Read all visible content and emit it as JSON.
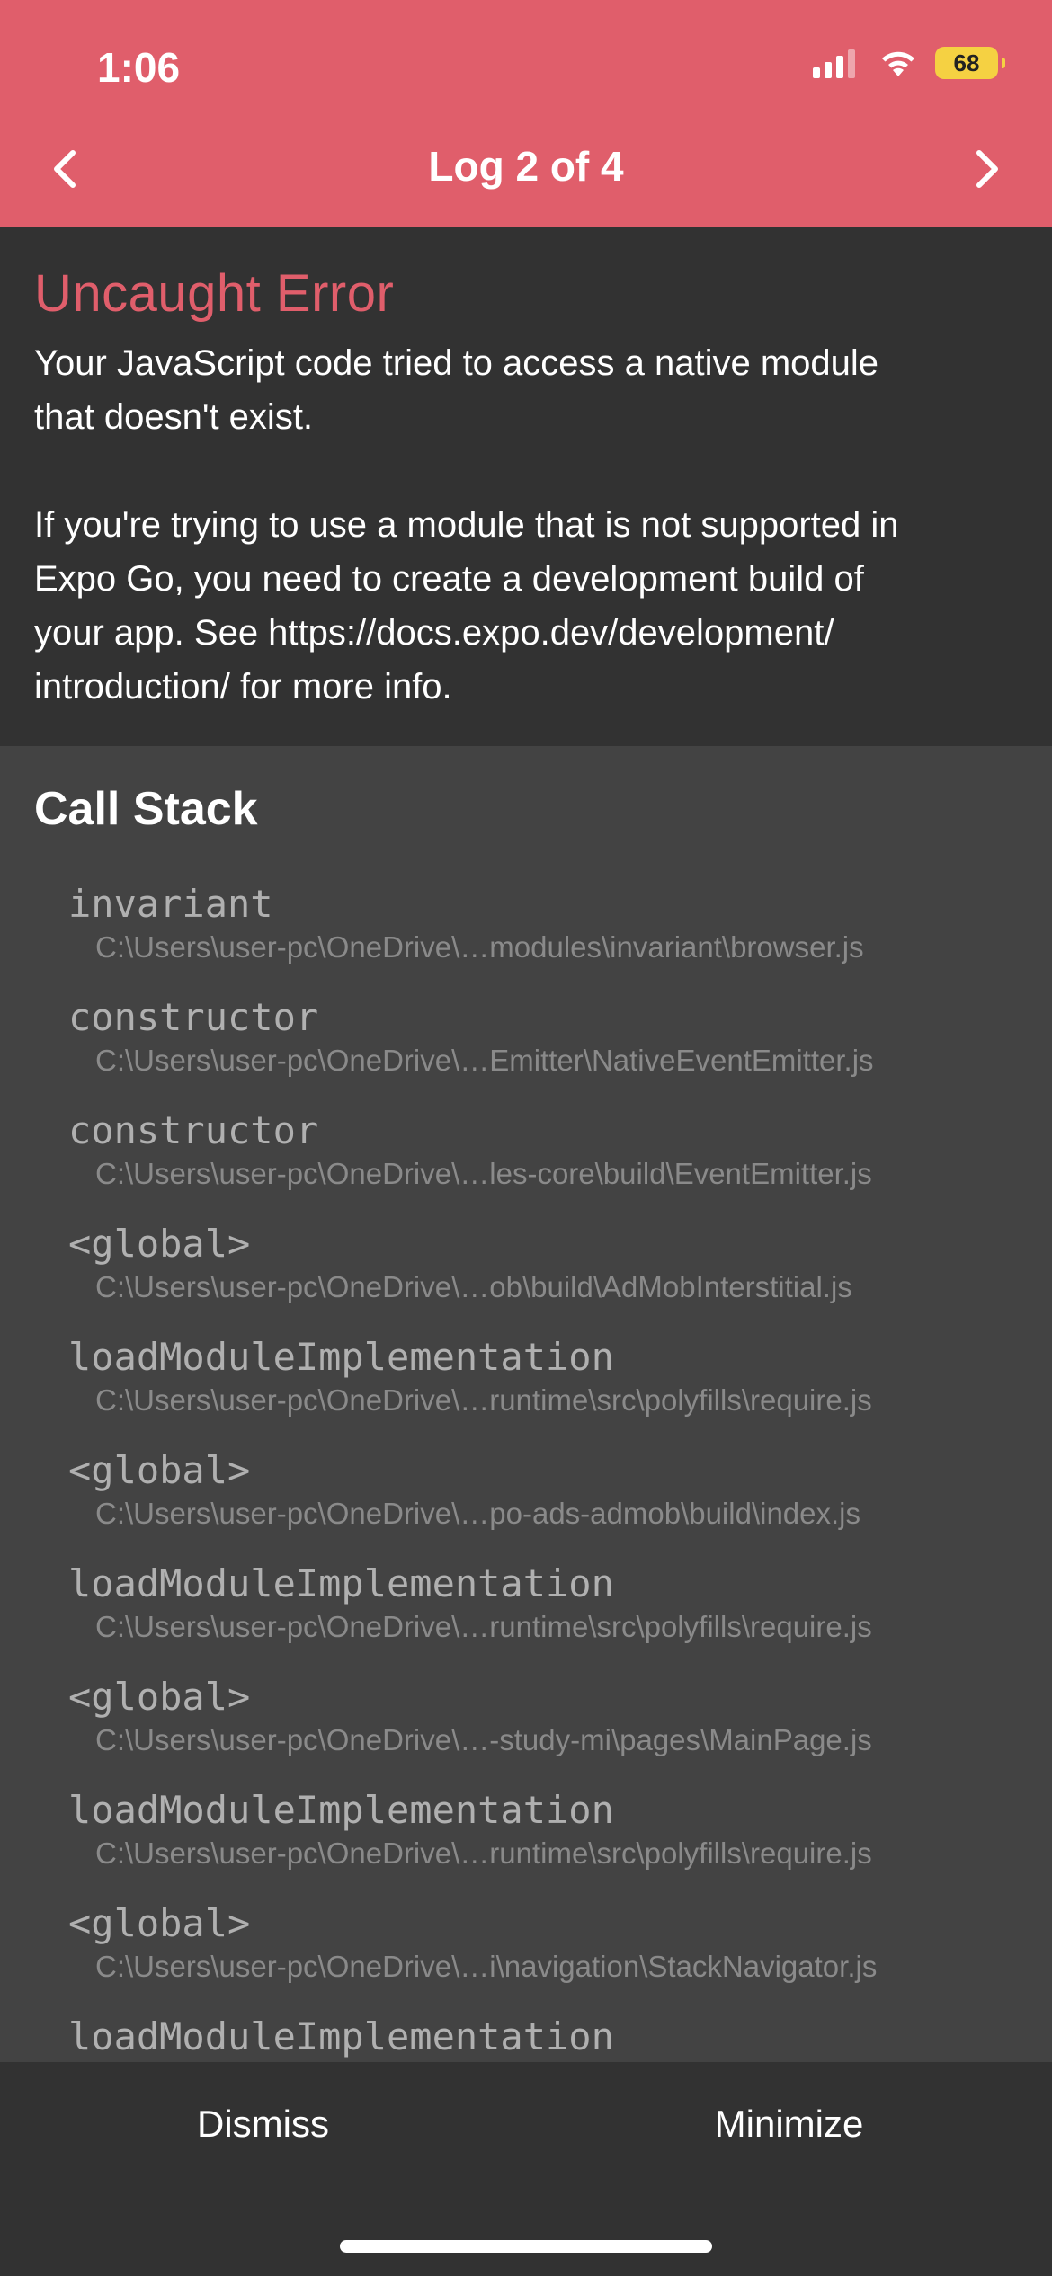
{
  "status_bar": {
    "time": "1:06",
    "battery": "68"
  },
  "nav": {
    "title": "Log 2 of 4"
  },
  "error": {
    "title": "Uncaught Error",
    "message": "Your JavaScript code tried to access a native module\nthat doesn't exist.\n\nIf you're trying to use a module that is not supported in\nExpo Go, you need to create a development build of\nyour app. See https://docs.expo.dev/development/\nintroduction/ for more info."
  },
  "call_stack": {
    "title": "Call Stack",
    "frames": [
      {
        "fn": "invariant",
        "file": "C:\\Users\\user-pc\\OneDrive\\…modules\\invariant\\browser.js"
      },
      {
        "fn": "constructor",
        "file": "C:\\Users\\user-pc\\OneDrive\\…Emitter\\NativeEventEmitter.js"
      },
      {
        "fn": "constructor",
        "file": "C:\\Users\\user-pc\\OneDrive\\…les-core\\build\\EventEmitter.js"
      },
      {
        "fn": "<global>",
        "file": "C:\\Users\\user-pc\\OneDrive\\…ob\\build\\AdMobInterstitial.js"
      },
      {
        "fn": "loadModuleImplementation",
        "file": "C:\\Users\\user-pc\\OneDrive\\…runtime\\src\\polyfills\\require.js"
      },
      {
        "fn": "<global>",
        "file": "C:\\Users\\user-pc\\OneDrive\\…po-ads-admob\\build\\index.js"
      },
      {
        "fn": "loadModuleImplementation",
        "file": "C:\\Users\\user-pc\\OneDrive\\…runtime\\src\\polyfills\\require.js"
      },
      {
        "fn": "<global>",
        "file": "C:\\Users\\user-pc\\OneDrive\\…-study-mi\\pages\\MainPage.js"
      },
      {
        "fn": "loadModuleImplementation",
        "file": "C:\\Users\\user-pc\\OneDrive\\…runtime\\src\\polyfills\\require.js"
      },
      {
        "fn": "<global>",
        "file": "C:\\Users\\user-pc\\OneDrive\\…i\\navigation\\StackNavigator.js"
      },
      {
        "fn": "loadModuleImplementation",
        "file": ""
      }
    ]
  },
  "footer": {
    "dismiss_label": "Dismiss",
    "minimize_label": "Minimize"
  },
  "colors": {
    "accent": "#e05e6b",
    "dark": "#323232",
    "stack_bg": "#434343",
    "battery": "#f5d142"
  },
  "icons": {
    "prev": "chevron-left-icon",
    "next": "chevron-right-icon",
    "signal": "cellular-signal-icon",
    "wifi": "wifi-icon",
    "battery": "battery-icon"
  }
}
